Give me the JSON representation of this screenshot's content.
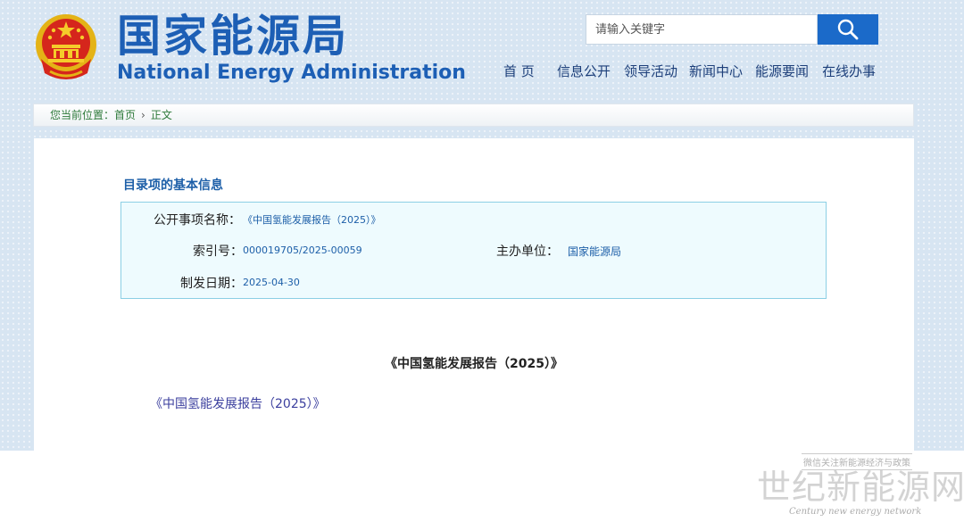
{
  "header": {
    "site_title_cn": "国家能源局",
    "site_title_en": "National Energy Administration",
    "emblem_icon": "national-emblem-icon"
  },
  "search": {
    "placeholder": "请输入关键字",
    "button_icon": "search-icon"
  },
  "nav": {
    "items": [
      {
        "label": "首  页"
      },
      {
        "label": "信息公开"
      },
      {
        "label": "领导活动"
      },
      {
        "label": "新闻中心"
      },
      {
        "label": "能源要闻"
      },
      {
        "label": "在线办事"
      }
    ]
  },
  "breadcrumb": {
    "prefix": "您当前位置：",
    "home": "首页",
    "separator": "›",
    "current": "正文"
  },
  "info": {
    "heading": "目录项的基本信息",
    "name_label": "公开事项名称：",
    "name_value": "《中国氢能发展报告（2025）》",
    "index_label": "索引号：",
    "index_value": "000019705/2025-00059",
    "org_label": "主办单位：",
    "org_value": "国家能源局",
    "date_label": "制发日期：",
    "date_value": "2025-04-30"
  },
  "article": {
    "title": "《中国氢能发展报告（2025）》",
    "attachment_link": "《中国氢能发展报告（2025）》"
  },
  "watermark": {
    "top": "微信关注新能源经济与政策",
    "main": "世纪新能源网",
    "en": "Century new energy network"
  },
  "colors": {
    "brand_blue": "#1d5fb5",
    "search_button": "#1b6ac9",
    "link_blue": "#1d5fa8",
    "breadcrumb_green": "#2e7a3a",
    "info_box_bg": "#eefbfe",
    "info_box_border": "#8ccfe4"
  }
}
